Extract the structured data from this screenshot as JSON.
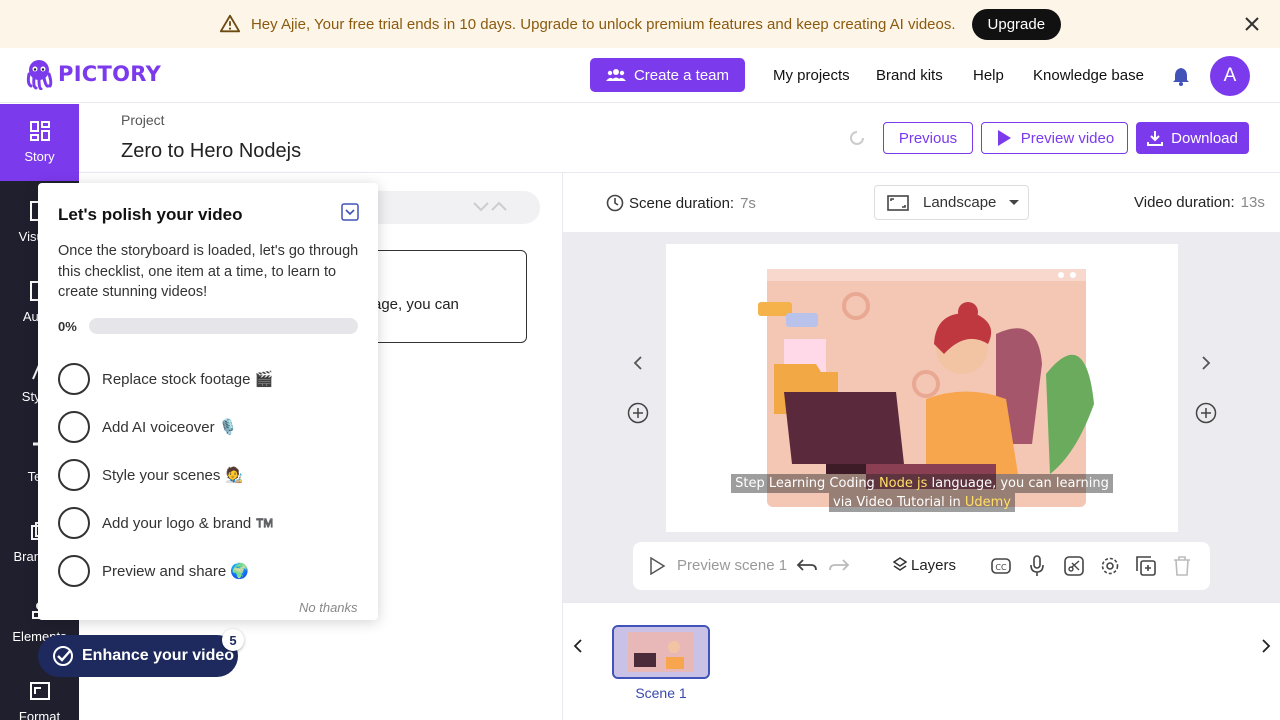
{
  "banner": {
    "message": "Hey Ajie, Your free trial ends in 10 days. Upgrade to unlock premium features and keep creating AI videos.",
    "upgrade_label": "Upgrade"
  },
  "header": {
    "logo_text": "PICTORY",
    "create_team_label": "Create a team",
    "nav": [
      "My projects",
      "Brand kits",
      "Help",
      "Knowledge base"
    ],
    "avatar_initial": "A"
  },
  "rail": {
    "items": [
      "Story",
      "Visuals",
      "Audio",
      "Styles",
      "Text",
      "Branding",
      "Elements",
      "Format"
    ]
  },
  "project": {
    "label": "Project",
    "title": "Zero to Hero Nodejs",
    "previous_label": "Previous",
    "preview_label": "Preview video",
    "download_label": "Download"
  },
  "story": {
    "scene_text_fragment": "age, you can"
  },
  "editor": {
    "scene_duration_label": "Scene duration:",
    "scene_duration_value": "7s",
    "aspect_label": "Landscape",
    "video_duration_label": "Video duration:",
    "video_duration_value": "13s",
    "subtitle_line1_pre": "Step Learning Coding ",
    "subtitle_line1_hl": "Node js",
    "subtitle_line1_post": " language, you can learning",
    "subtitle_line2_pre": "via Video Tutorial in ",
    "subtitle_line2_hl": "Udemy",
    "preview_scene_label": "Preview scene 1",
    "layers_label": "Layers",
    "scene_thumb_label": "Scene 1"
  },
  "checklist": {
    "title": "Let's polish your video",
    "description": "Once the storyboard is loaded, let's go through this checklist, one item at a time, to learn to create stunning videos!",
    "progress_label": "0%",
    "progress": 0,
    "items": [
      "Replace stock footage 🎬",
      "Add AI voiceover 🎙️",
      "Style your scenes 🧑‍🎨",
      "Add your logo & brand ™️",
      "Preview and share 🌍"
    ],
    "no_thanks": "No thanks"
  },
  "enhance": {
    "label": "Enhance your video",
    "badge": "5"
  },
  "colors": {
    "brand": "#7c3aed",
    "navy": "#1e2a5e",
    "rail_bg": "#1f1f2e",
    "banner_bg": "#fdf6e8"
  }
}
